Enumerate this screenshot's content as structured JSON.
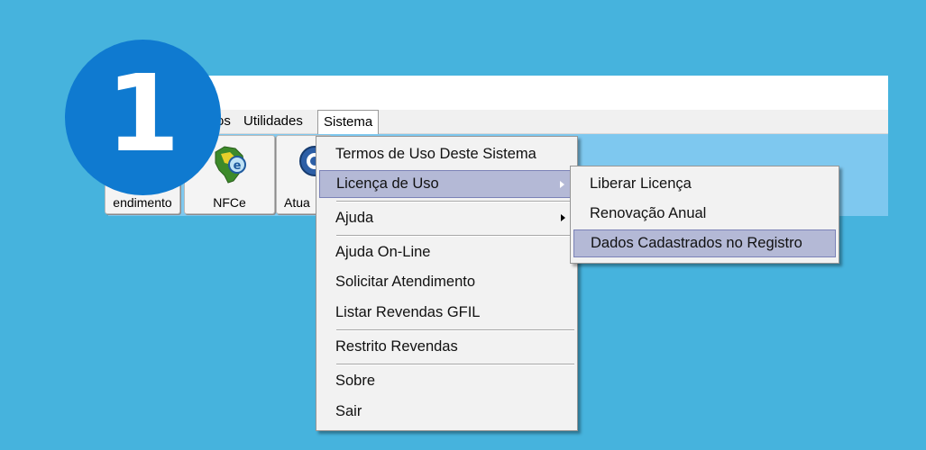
{
  "step_badge": "1",
  "menubar": {
    "partial_left": "os",
    "items": [
      {
        "label": "Utilidades"
      },
      {
        "label": "Sistema"
      }
    ]
  },
  "toolbar": {
    "buttons": [
      {
        "label": "endimento"
      },
      {
        "label": "NFCe"
      },
      {
        "label": "Atua"
      }
    ]
  },
  "sistema_menu": {
    "items": [
      {
        "label": "Termos de Uso Deste Sistema"
      },
      {
        "label": "Licença de Uso"
      },
      {
        "label": "Ajuda"
      },
      {
        "label": "Ajuda On-Line"
      },
      {
        "label": "Solicitar Atendimento"
      },
      {
        "label": "Listar Revendas GFIL"
      },
      {
        "label": "Restrito Revendas"
      },
      {
        "label": "Sobre"
      },
      {
        "label": "Sair"
      }
    ]
  },
  "licenca_submenu": {
    "items": [
      {
        "label": "Liberar Licença"
      },
      {
        "label": "Renovação Anual"
      },
      {
        "label": "Dados Cadastrados no Registro"
      }
    ]
  },
  "colors": {
    "background": "#46b3dd",
    "badge": "#0f7ad0",
    "highlight": "#b4b9d6",
    "toolbar": "#7ec8ef"
  }
}
